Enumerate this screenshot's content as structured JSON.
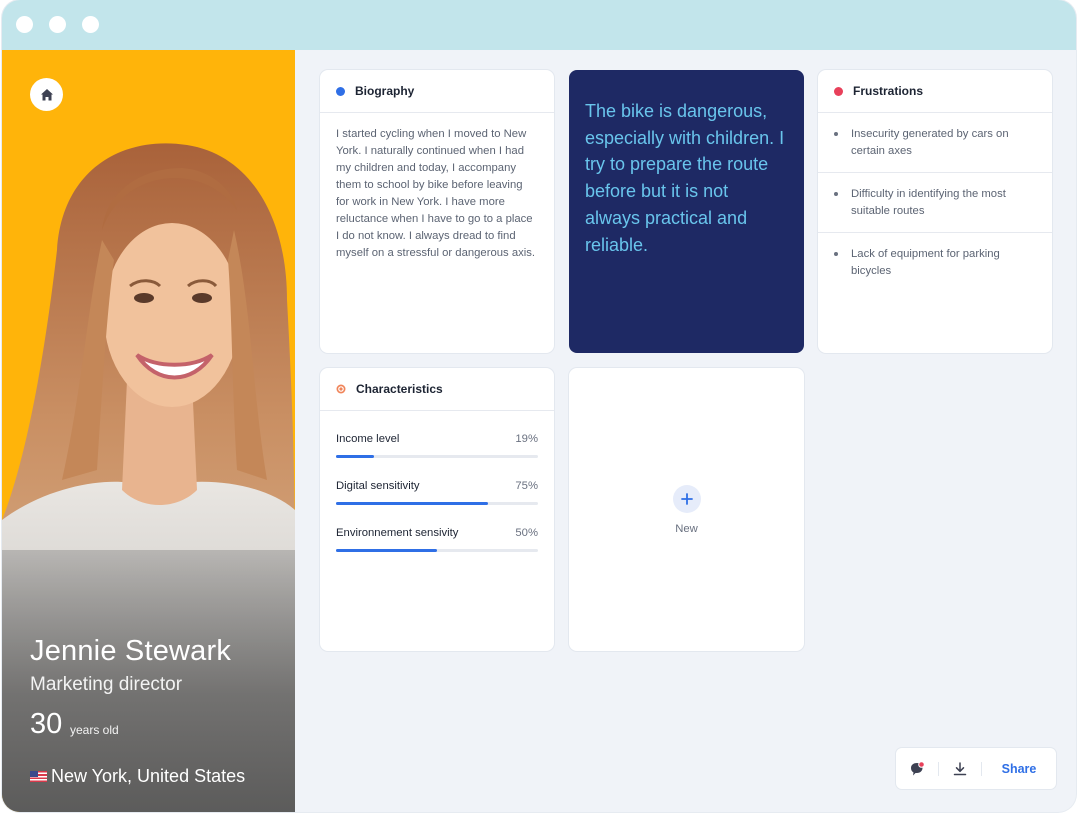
{
  "profile": {
    "name": "Jennie Stewark",
    "role": "Marketing director",
    "age": "30",
    "age_unit": "years old",
    "location": "New York, United States",
    "background_color": "#ffb40a"
  },
  "biography": {
    "title": "Biography",
    "dot_color": "#2f6fe6",
    "text": "I started cycling when I moved to New York. I naturally continued when I had my children and today, I accompany them to school by bike before leaving for work in New York. I have more reluctance when I have to go to a place I do not know. I always dread to find myself on a stressful or dangerous axis."
  },
  "quote": {
    "text": "The bike is dangerous, especially with children. I try to prepare the route before but it is not always practical and reliable.",
    "background": "#1e2964",
    "text_color": "#69c5ec"
  },
  "frustrations": {
    "title": "Frustrations",
    "dot_color": "#e8405a",
    "items": [
      {
        "text": "Insecurity generated by cars on certain axes"
      },
      {
        "text": "Difficulty in identifying the most suitable routes"
      },
      {
        "text": "Lack of equipment for parking bicycles"
      }
    ]
  },
  "characteristics": {
    "title": "Characteristics",
    "dot_color": "#f0855a",
    "metrics": [
      {
        "label": "Income level",
        "pct_label": "19%",
        "value": 0.19
      },
      {
        "label": "Digital sensitivity",
        "pct_label": "75%",
        "value": 0.75
      },
      {
        "label": "Environnement sensivity",
        "pct_label": "50%",
        "value": 0.5
      }
    ]
  },
  "new_card": {
    "label": "New"
  },
  "toolbar": {
    "share_label": "Share",
    "accent": "#2f6fe6"
  },
  "icons": {
    "home": "home-icon",
    "comment": "comment-icon",
    "download": "download-icon",
    "plus": "plus-icon"
  }
}
